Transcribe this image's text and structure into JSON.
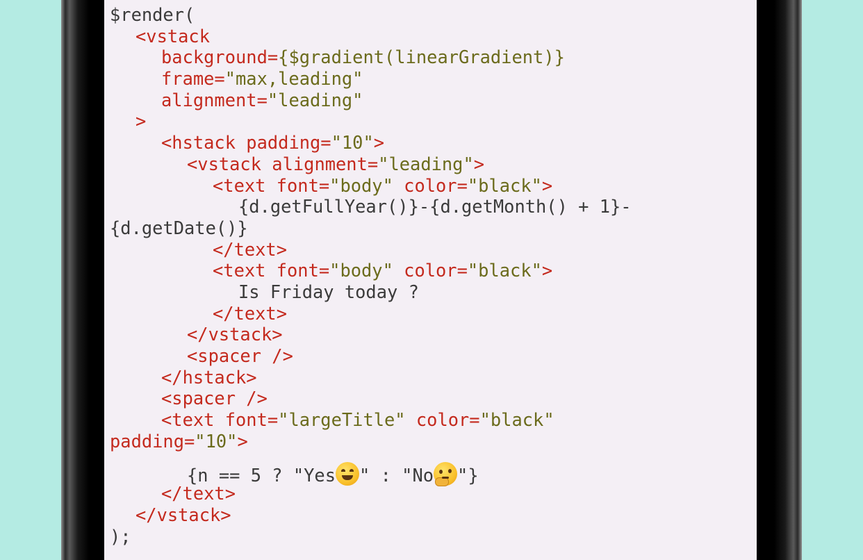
{
  "code": {
    "l1": "$render(",
    "l2_tag": "<vstack",
    "l3_attr": "background=",
    "l3_val": "{$gradient(linearGradient)}",
    "l4_attr": "frame=",
    "l4_val": "\"max,leading\"",
    "l5_attr": "alignment=",
    "l5_val": "\"leading\"",
    "l6_tag": ">",
    "l7_tag": "<hstack",
    "l7_attr": " padding=",
    "l7_val": "\"10\"",
    "l7_end": ">",
    "l8_tag": "<vstack",
    "l8_attr": " alignment=",
    "l8_val": "\"leading\"",
    "l8_end": ">",
    "l9_tag": "<text",
    "l9_attr1": " font=",
    "l9_val1": "\"body\"",
    "l9_attr2": " color=",
    "l9_val2": "\"black\"",
    "l9_end": ">",
    "l10": "{d.getFullYear()}-{d.getMonth() + 1}-",
    "l11": "{d.getDate()}",
    "l12_tag": "</text>",
    "l13_tag": "<text",
    "l13_attr1": " font=",
    "l13_val1": "\"body\"",
    "l13_attr2": " color=",
    "l13_val2": "\"black\"",
    "l13_end": ">",
    "l14": "Is Friday today ?",
    "l15_tag": "</text>",
    "l16_tag": "</vstack>",
    "l17_tag": "<spacer />",
    "l18_tag": "</hstack>",
    "l19_tag": "<spacer />",
    "l20_tag": "<text",
    "l20_attr1": " font=",
    "l20_val1": "\"largeTitle\"",
    "l20_attr2": " color=",
    "l20_val2": "\"black\"",
    "l21_attr": "padding=",
    "l21_val": "\"10\"",
    "l21_end": ">",
    "l22_a": "{n == 5 ? \"Yes",
    "l22_b": "\" : \"No",
    "l22_c": "\"}",
    "l22_emoji1": "smiling-face-emoji",
    "l22_emoji2": "thinking-face-emoji",
    "l23_tag": "</text>",
    "l24_tag": "</vstack>",
    "l25": ");"
  }
}
